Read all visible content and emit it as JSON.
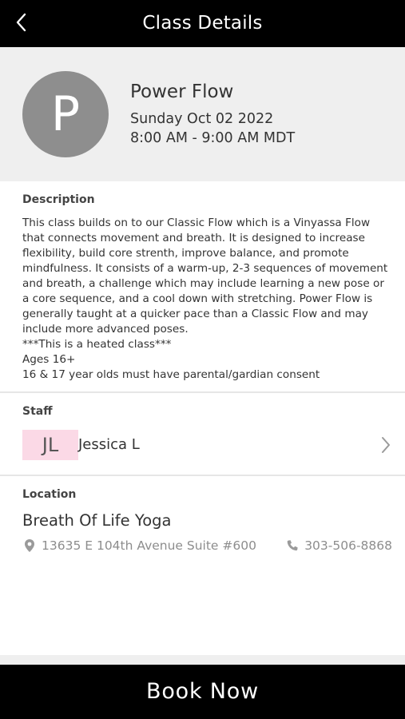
{
  "topbar": {
    "title": "Class Details",
    "back_icon": "chevron-left-icon"
  },
  "class_info": {
    "avatar_letter": "P",
    "name": "Power Flow",
    "date": "Sunday Oct 02 2022",
    "time": "8:00 AM - 9:00 AM MDT"
  },
  "description": {
    "label": "Description",
    "text": "This class builds on to our Classic Flow which is a Vinyassa Flow that connects movement and breath. It is designed to increase flexibility, build core strenth, improve balance, and promote mindfulness. It consists of a warm-up, 2-3 sequences of movement and breath, a challenge which may include learning a new pose or a core sequence, and a cool down with stretching. Power Flow is generally taught at a quicker pace than a Classic Flow and may include more advanced poses.\n***This is a heated class***\nAges 16+\n16 & 17 year olds must have parental/gardian consent"
  },
  "staff": {
    "label": "Staff",
    "initials": "JL",
    "name": "Jessica L",
    "initials_bg": "#fbd9e6"
  },
  "location": {
    "label": "Location",
    "name": "Breath Of Life Yoga",
    "address": "13635 E 104th Avenue Suite #600",
    "phone": "303-506-8868",
    "address_icon": "map-pin-icon",
    "phone_icon": "phone-icon"
  },
  "actions": {
    "book_label": "Book Now"
  },
  "colors": {
    "bar": "#000000",
    "header_bg": "#efefef",
    "avatar_bg": "#8e8e8e",
    "muted_text": "#8d8d8d"
  }
}
